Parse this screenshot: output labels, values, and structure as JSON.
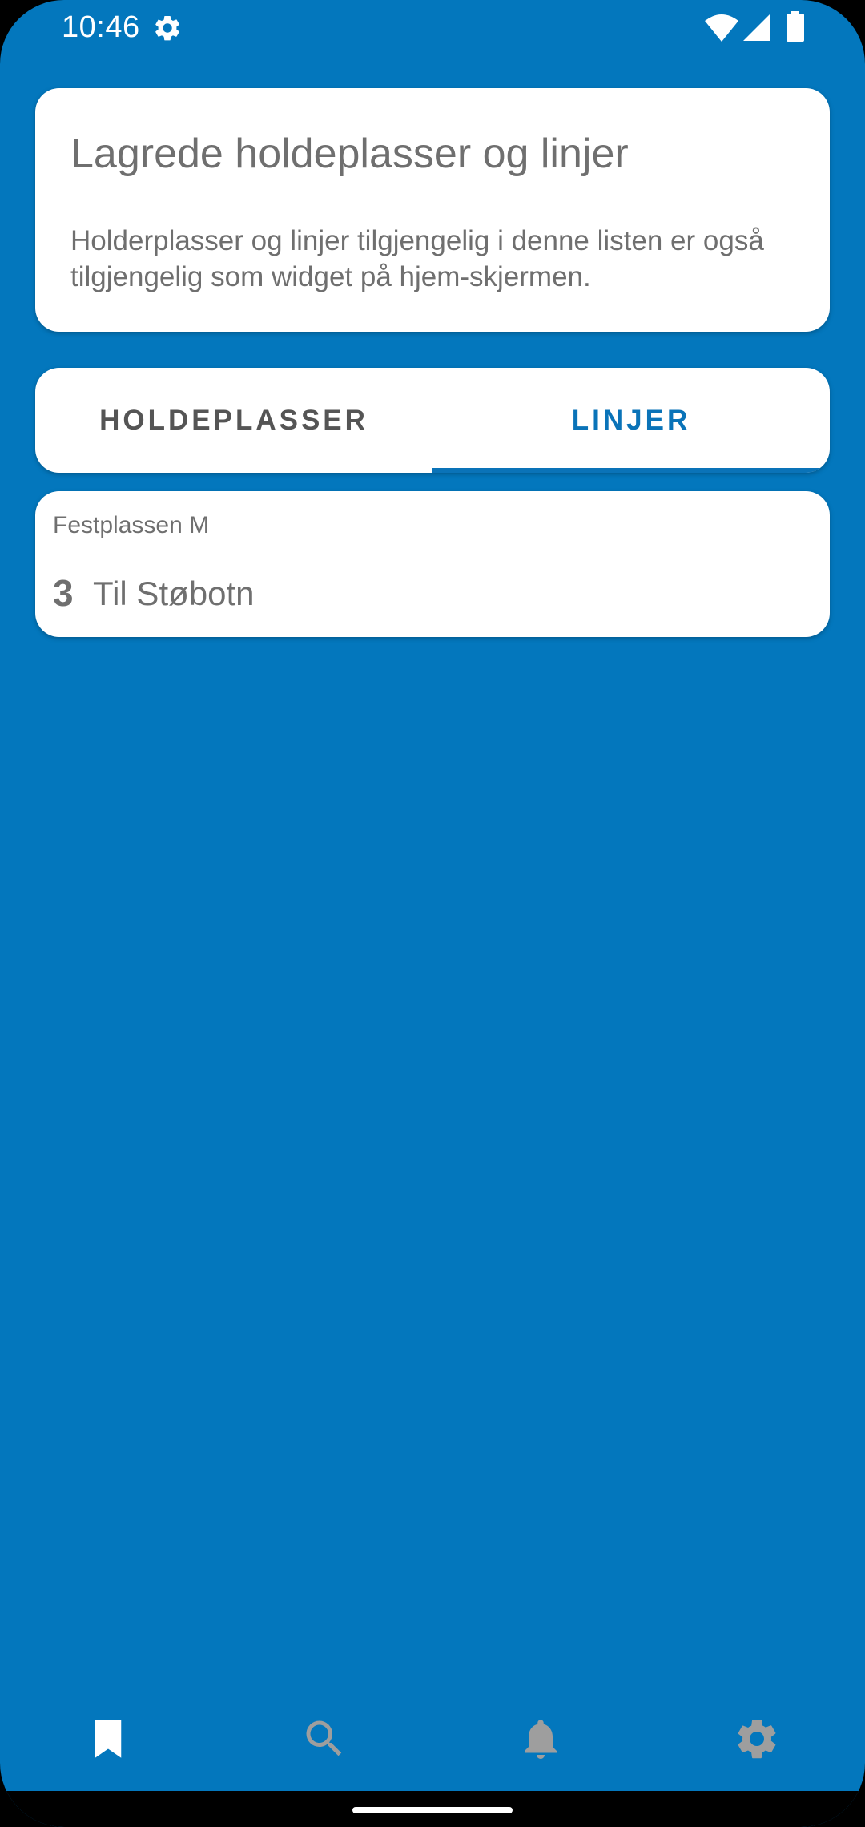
{
  "status_bar": {
    "time": "10:46",
    "icons": [
      "settings-icon",
      "wifi-icon",
      "signal-icon",
      "battery-icon"
    ]
  },
  "info_card": {
    "title": "Lagrede holdeplasser og linjer",
    "description": "Holderplasser og linjer tilgjengelig i denne listen er også tilgjengelig som widget på hjem-skjermen."
  },
  "tabs": [
    {
      "label": "HOLDEPLASSER",
      "selected": false
    },
    {
      "label": "LINJER",
      "selected": true
    }
  ],
  "saved_lines": [
    {
      "stop": "Festplassen M",
      "line_number": "3",
      "direction": "Til Støbotn"
    }
  ],
  "bottom_nav": [
    {
      "icon": "bookmark-icon",
      "selected": true
    },
    {
      "icon": "search-icon",
      "selected": false
    },
    {
      "icon": "bell-icon",
      "selected": false
    },
    {
      "icon": "settings-icon",
      "selected": false
    }
  ],
  "colors": {
    "background": "#0377bd",
    "card": "#ffffff",
    "accent": "#0a73b8",
    "text": "#6f6f6f",
    "nav_selected": "#ffffff",
    "nav_unselected": "#9e9e9e"
  }
}
